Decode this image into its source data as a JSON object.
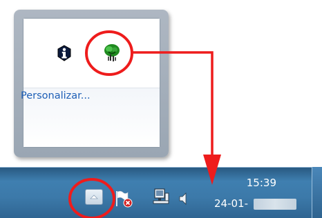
{
  "overflow_popup": {
    "customize_link": "Personalizar...",
    "icons": [
      "info-icon",
      "network-status-icon"
    ]
  },
  "taskbar": {
    "show_hidden_icons_icon": "chevron-up-icon",
    "tray_icons": [
      "action-center-flag-icon",
      "network-icon",
      "volume-icon"
    ],
    "clock_time": "15:39",
    "clock_date": "24-01-"
  },
  "annotation_color": "#ee1c1c"
}
